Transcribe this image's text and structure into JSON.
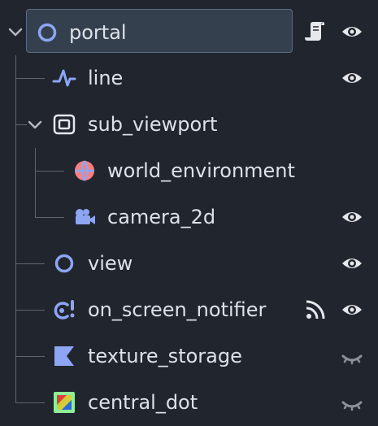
{
  "tree": {
    "nodes": [
      {
        "label": "portal",
        "icon": "circle-node-icon",
        "selected": true,
        "has_script": true,
        "visible": true
      },
      {
        "label": "line",
        "icon": "line2d-icon",
        "visible": true
      },
      {
        "label": "sub_viewport",
        "icon": "subviewport-icon",
        "expanded": true
      },
      {
        "label": "world_environment",
        "icon": "world-environment-icon"
      },
      {
        "label": "camera_2d",
        "icon": "camera2d-icon",
        "visible": true
      },
      {
        "label": "view",
        "icon": "circle-node-icon",
        "visible": true
      },
      {
        "label": "on_screen_notifier",
        "icon": "visibility-notifier-icon",
        "has_signal": true,
        "visible": true
      },
      {
        "label": "texture_storage",
        "icon": "texture-storage-icon",
        "visible": false
      },
      {
        "label": "central_dot",
        "icon": "texture-rect-icon",
        "visible": false
      }
    ]
  },
  "colors": {
    "background": "#21252e",
    "selection": "#35404f",
    "node_blue": "#8da5f3",
    "text": "#dde1e8"
  }
}
